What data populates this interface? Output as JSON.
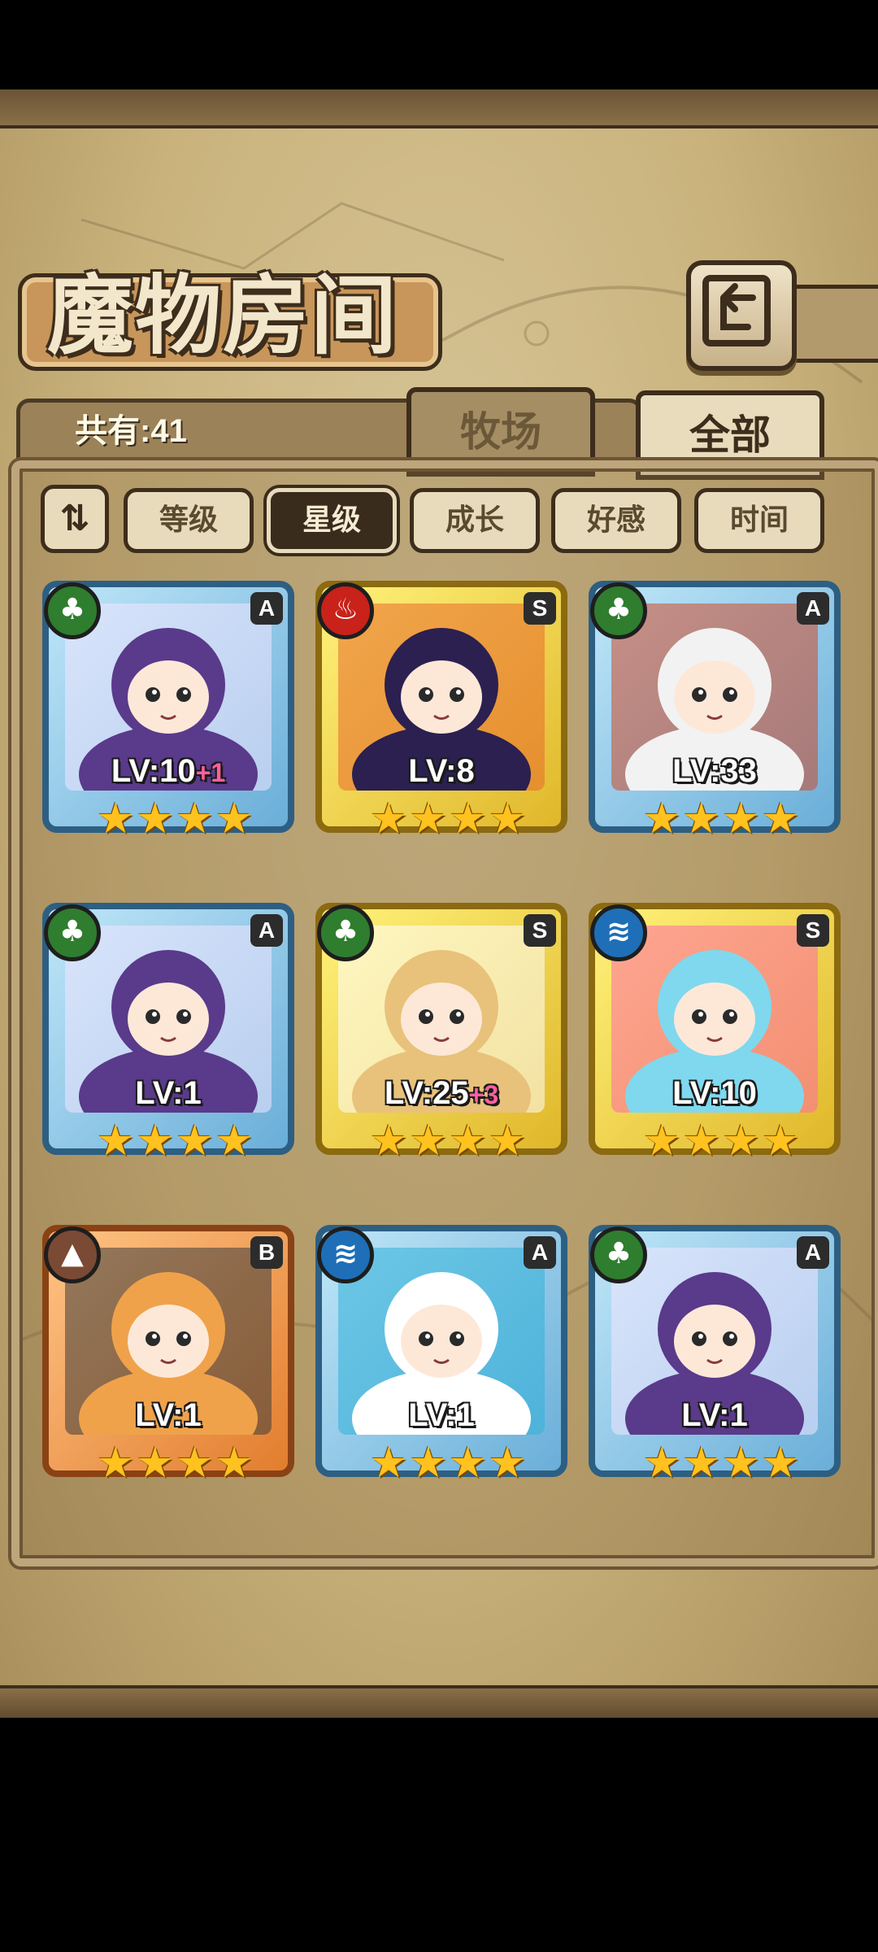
{
  "header": {
    "title": "魔物房间",
    "back_icon": "return-icon"
  },
  "collection": {
    "count_label": "共有:41"
  },
  "tabs": [
    {
      "label": "牧场",
      "active": false
    },
    {
      "label": "全部",
      "active": true
    }
  ],
  "sort": {
    "toggle_icon": "sort-order-icon",
    "toggle_glyph": "⇅",
    "buttons": [
      {
        "label": "等级",
        "active": false
      },
      {
        "label": "星级",
        "active": true
      },
      {
        "label": "成长",
        "active": false
      },
      {
        "label": "好感",
        "active": false
      },
      {
        "label": "时间",
        "active": false
      }
    ]
  },
  "monsters": [
    {
      "element": "grass",
      "rank": "A",
      "level": "LV:10",
      "bonus": "+1",
      "stars": 4,
      "colors": [
        "#5a3a8a",
        "#f3e6ff"
      ]
    },
    {
      "element": "fire",
      "rank": "S",
      "level": "LV:8",
      "bonus": "",
      "stars": 4,
      "colors": [
        "#2b2050",
        "#e86a2c"
      ]
    },
    {
      "element": "grass",
      "rank": "A",
      "level": "LV:33",
      "bonus": "",
      "stars": 4,
      "colors": [
        "#f2f2f2",
        "#d04a2a"
      ]
    },
    {
      "element": "grass",
      "rank": "A",
      "level": "LV:1",
      "bonus": "",
      "stars": 4,
      "colors": [
        "#5a3a8a",
        "#f3e6ff"
      ]
    },
    {
      "element": "grass",
      "rank": "S",
      "level": "LV:25",
      "bonus": "+3",
      "stars": 4,
      "colors": [
        "#e8c27a",
        "#ffffff"
      ]
    },
    {
      "element": "water",
      "rank": "S",
      "level": "LV:10",
      "bonus": "",
      "stars": 4,
      "colors": [
        "#7fd8ee",
        "#ff6aa8"
      ]
    },
    {
      "element": "earth",
      "rank": "B",
      "level": "LV:1",
      "bonus": "",
      "stars": 4,
      "colors": [
        "#f0a24a",
        "#3c3c3c"
      ]
    },
    {
      "element": "water",
      "rank": "A",
      "level": "LV:1",
      "bonus": "",
      "stars": 4,
      "colors": [
        "#ffffff",
        "#2fb0d8"
      ]
    },
    {
      "element": "grass",
      "rank": "A",
      "level": "LV:1",
      "bonus": "",
      "stars": 4,
      "colors": [
        "#5a3a8a",
        "#f3e6ff"
      ]
    }
  ],
  "element_glyphs": {
    "grass": "♣",
    "fire": "♨",
    "water": "≋",
    "earth": "▲"
  },
  "star_glyph": "★"
}
